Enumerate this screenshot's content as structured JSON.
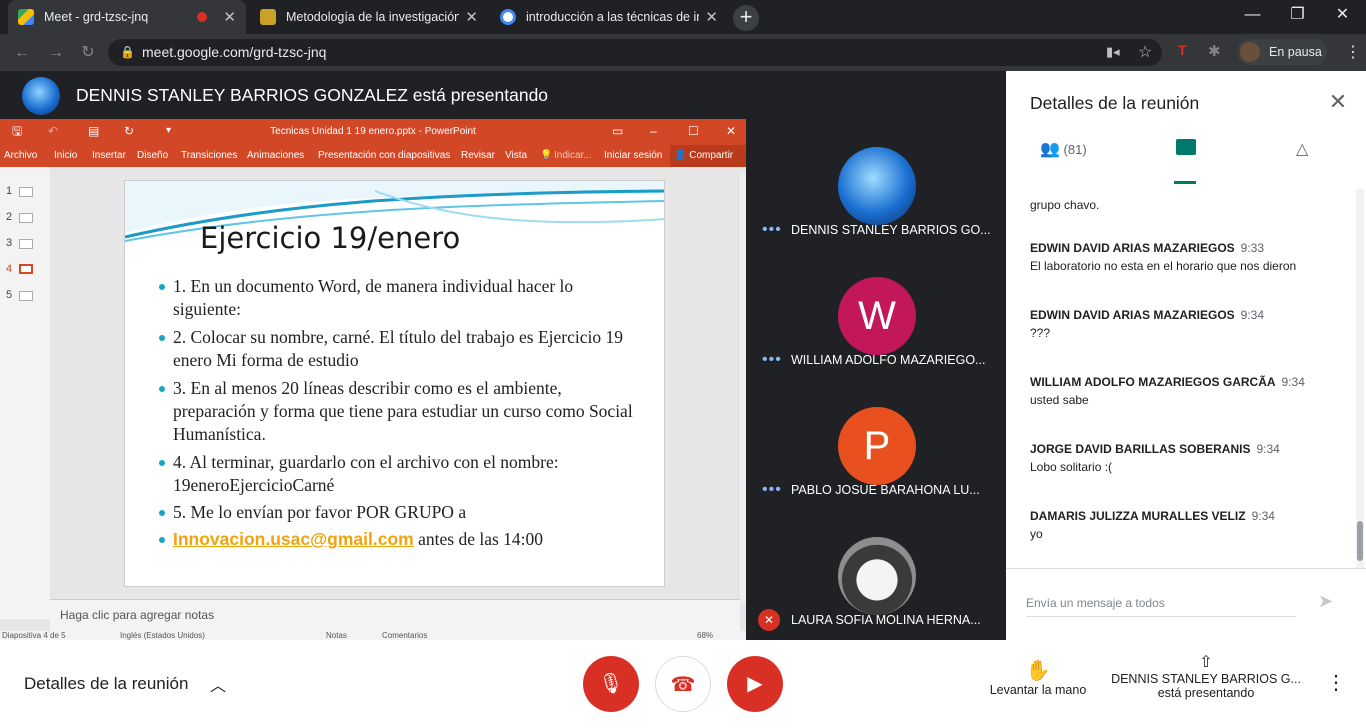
{
  "browser": {
    "tabs": [
      {
        "title": "Meet - grd-tzsc-jnq",
        "close": "✕"
      },
      {
        "title": "Metodología de la investigación",
        "close": "✕"
      },
      {
        "title": "introducción a las técnicas de inv",
        "close": "✕"
      }
    ],
    "new_tab": "+",
    "window_controls": {
      "minimize": "—",
      "maximize": "❐",
      "close": "✕"
    },
    "url": "meet.google.com/grd-tzsc-jnq",
    "profile_label": "En pausa"
  },
  "meet": {
    "presenting_banner": "DENNIS STANLEY BARRIOS GONZALEZ está presentando",
    "participants": [
      {
        "name": "DENNIS STANLEY BARRIOS GO...",
        "initial": "",
        "avatar_color": "#1a6fd1",
        "muted": false
      },
      {
        "name": "WILLIAM ADOLFO MAZARIEGO...",
        "initial": "W",
        "avatar_color": "#c2185b",
        "muted": false
      },
      {
        "name": "PABLO JOSUE BARAHONA LU...",
        "initial": "P",
        "avatar_color": "#e8501f",
        "muted": false
      },
      {
        "name": "LAURA SOFIA MOLINA HERNA...",
        "initial": "",
        "avatar_color": "#8d8d8d",
        "muted": true
      }
    ],
    "bottom": {
      "details_label": "Detalles de la reunión",
      "raise_hand": "Levantar la mano",
      "presenting_line1": "DENNIS STANLEY BARRIOS G...",
      "presenting_line2": "está presentando"
    }
  },
  "panel": {
    "title": "Detalles de la reunión",
    "people_count": "(81)",
    "messages": [
      {
        "sender": "",
        "time": "",
        "text": "grupo chavo."
      },
      {
        "sender": "EDWIN DAVID ARIAS MAZARIEGOS",
        "time": "9:33",
        "text": "El laboratorio no esta en el horario que nos dieron"
      },
      {
        "sender": "EDWIN DAVID ARIAS MAZARIEGOS",
        "time": "9:34",
        "text": "???"
      },
      {
        "sender": "WILLIAM ADOLFO MAZARIEGOS GARCÃA",
        "time": "9:34",
        "text": "usted sabe"
      },
      {
        "sender": "JORGE DAVID BARILLAS SOBERANIS",
        "time": "9:34",
        "text": "Lobo solitario :("
      },
      {
        "sender": "DAMARIS JULIZZA MURALLES VELIZ",
        "time": "9:34",
        "text": "yo"
      }
    ],
    "input_placeholder": "Envía un mensaje a todos"
  },
  "powerpoint": {
    "window_title": "Tecnicas Unidad 1 19 enero.pptx - PowerPoint",
    "ribbon": [
      "Archivo",
      "Inicio",
      "Insertar",
      "Diseño",
      "Transiciones",
      "Animaciones",
      "Presentación con diapositivas",
      "Revisar",
      "Vista",
      "Indicar...",
      "Iniciar sesión",
      "Compartir"
    ],
    "slide_numbers": [
      "1",
      "2",
      "3",
      "4",
      "5"
    ],
    "current_slide": "4",
    "slide": {
      "title": "Ejercicio 19/enero",
      "bullets": [
        "1. En un documento Word, de manera individual hacer lo siguiente:",
        "2. Colocar su nombre, carné. El título del trabajo es Ejercicio  19 enero Mi forma de estudio",
        "3. En al menos 20 líneas describir como es el ambiente, preparación y forma que tiene para estudiar un curso como Social Humanística.",
        "4. Al terminar, guardarlo con el archivo con el nombre: 19eneroEjercicioCarné",
        "5. Me lo envían por favor POR GRUPO a"
      ],
      "email": "Innovacion.usac@gmail.com",
      "email_suffix": " antes de las 14:00"
    },
    "notes_placeholder": "Haga clic para agregar notas",
    "status": {
      "slide_of": "Diapositiva 4 de 5",
      "language": "Inglés (Estados Unidos)",
      "notes": "Notas",
      "comments": "Comentarios",
      "zoom": "68%"
    }
  }
}
